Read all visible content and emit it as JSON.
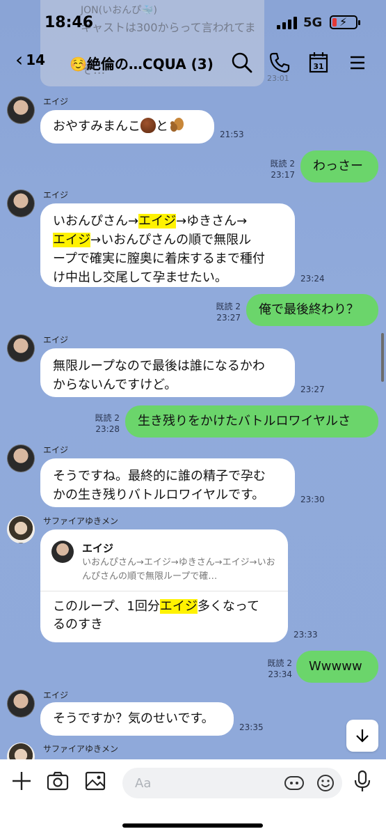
{
  "status": {
    "time": "18:46",
    "network": "5G"
  },
  "ghost": {
    "name": "JON(いおんぴ🐳)",
    "line1": "キャストは300からって言われてま",
    "line2": "そ...",
    "time": "23:01"
  },
  "header": {
    "back_count": "14",
    "title": "☺️絶倫の…CQUA (3)",
    "calendar_day": "31"
  },
  "messages": [
    {
      "sender": "エイジ",
      "text_pre": "おやすみまんこ",
      "text_mid": "と",
      "time": "21:53"
    },
    {
      "read": "既読 2",
      "time": "23:17",
      "text": "わっさー"
    },
    {
      "sender": "エイジ",
      "line1_pre": "いおんぴさん→",
      "hl1": "エイジ",
      "line1_post": "→ゆきさん→",
      "hl2": "エイジ",
      "line2_post": "→いおんぴさんの順で無限ル",
      "line3": "ープで確実に膣奥に着床するまで種付",
      "line4": "け中出し交尾して孕ませたい。",
      "time": "23:24"
    },
    {
      "read": "既読 2",
      "time": "23:27",
      "text": "俺で最後終わり？"
    },
    {
      "sender": "エイジ",
      "line1": "無限ループなので最後は誰になるかわ",
      "line2": "からないんですけど。",
      "time": "23:27"
    },
    {
      "read": "既読 2",
      "time": "23:28",
      "text": "生き残りをかけたバトルロワイヤルさ"
    },
    {
      "sender": "エイジ",
      "line1": "そうですね。最終的に誰の精子で孕む",
      "line2": "かの生き残りバトルロワイヤルです。",
      "time": "23:30"
    },
    {
      "sender": "サファイアゆきメン",
      "quote_name": "エイジ",
      "quote_text": "いおんぴさん→エイジ→ゆきさん→エイジ→いおんぴさんの順で無限ループで確…",
      "body_pre": "このループ、1回分",
      "body_hl": "エイジ",
      "body_post": "多くなって",
      "body_line2": "るのすき",
      "time": "23:33"
    },
    {
      "read": "既読 2",
      "time": "23:34",
      "text": "Wwwww"
    },
    {
      "sender": "エイジ",
      "text": "そうですか？気のせいです。",
      "time": "23:35"
    },
    {
      "sender": "サファイアゆきメン"
    }
  ],
  "input": {
    "placeholder": "Aa"
  },
  "icons": [
    "back-chevron-icon",
    "search-icon",
    "phone-icon",
    "calendar-icon",
    "menu-icon",
    "scroll-down-icon",
    "plus-icon",
    "camera-icon",
    "image-icon",
    "emoji-chestnut-icon",
    "emoji-squirrel-icon",
    "sticker-icon",
    "smiley-icon",
    "microphone-icon"
  ],
  "colors": {
    "chat_bg": "#8ca6d8",
    "my_bubble": "#6bd56b",
    "highlight": "#fff200"
  }
}
